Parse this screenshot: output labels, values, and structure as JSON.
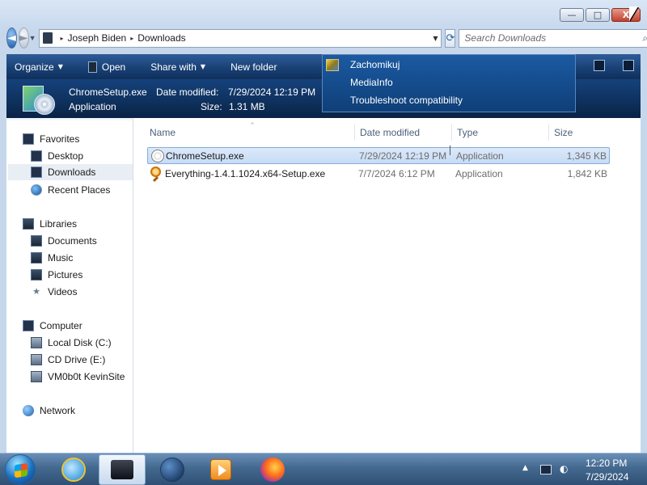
{
  "window": {
    "minimize_glyph": "—",
    "maximize_glyph": "□",
    "close_glyph": "X"
  },
  "address": {
    "back_glyph": "◄",
    "forward_glyph": "►",
    "breadcrumb": [
      "Joseph Biden",
      "Downloads"
    ],
    "separator": "▸",
    "dropdown_glyph": "▼",
    "refresh_glyph": "⟳",
    "search_placeholder": "Search Downloads",
    "search_icon": "⌕"
  },
  "commands": {
    "organize": "Organize",
    "open": "Open",
    "share_with": "Share with",
    "new_folder": "New folder",
    "arrow_glyph": "▼"
  },
  "details": {
    "filename": "ChromeSetup.exe",
    "modified_label": "Date modified:",
    "modified_value": "7/29/2024 12:19 PM",
    "type": "Application",
    "size_label": "Size:",
    "size_value": "1.31 MB"
  },
  "context_menu": {
    "items": [
      "Zachomikuj",
      "MediaInfo",
      "Troubleshoot compatibility"
    ]
  },
  "nav": {
    "favorites": "Favorites",
    "desktop": "Desktop",
    "downloads": "Downloads",
    "recent_places": "Recent Places",
    "libraries": "Libraries",
    "documents": "Documents",
    "music": "Music",
    "pictures": "Pictures",
    "videos": "Videos",
    "computer": "Computer",
    "local_disk": "Local Disk (C:)",
    "cd_drive": "CD Drive (E:)",
    "vm_share": "VM0b0t KevinSite",
    "network": "Network",
    "star_glyph": "★"
  },
  "columns": {
    "name": "Name",
    "date_modified": "Date modified",
    "type": "Type",
    "size": "Size",
    "sort_glyph": "^"
  },
  "files": [
    {
      "name": "ChromeSetup.exe",
      "date": "7/29/2024 12:19 PM",
      "type": "Application",
      "size": "1,345 KB"
    },
    {
      "name": "Everything-1.4.1.1024.x64-Setup.exe",
      "date": "7/7/2024 6:12 PM",
      "type": "Application",
      "size": "1,842 KB"
    }
  ],
  "taskbar": {
    "tray_chevron": "▲",
    "speaker_glyph": "◐",
    "time": "12:20 PM",
    "date": "7/29/2024"
  }
}
